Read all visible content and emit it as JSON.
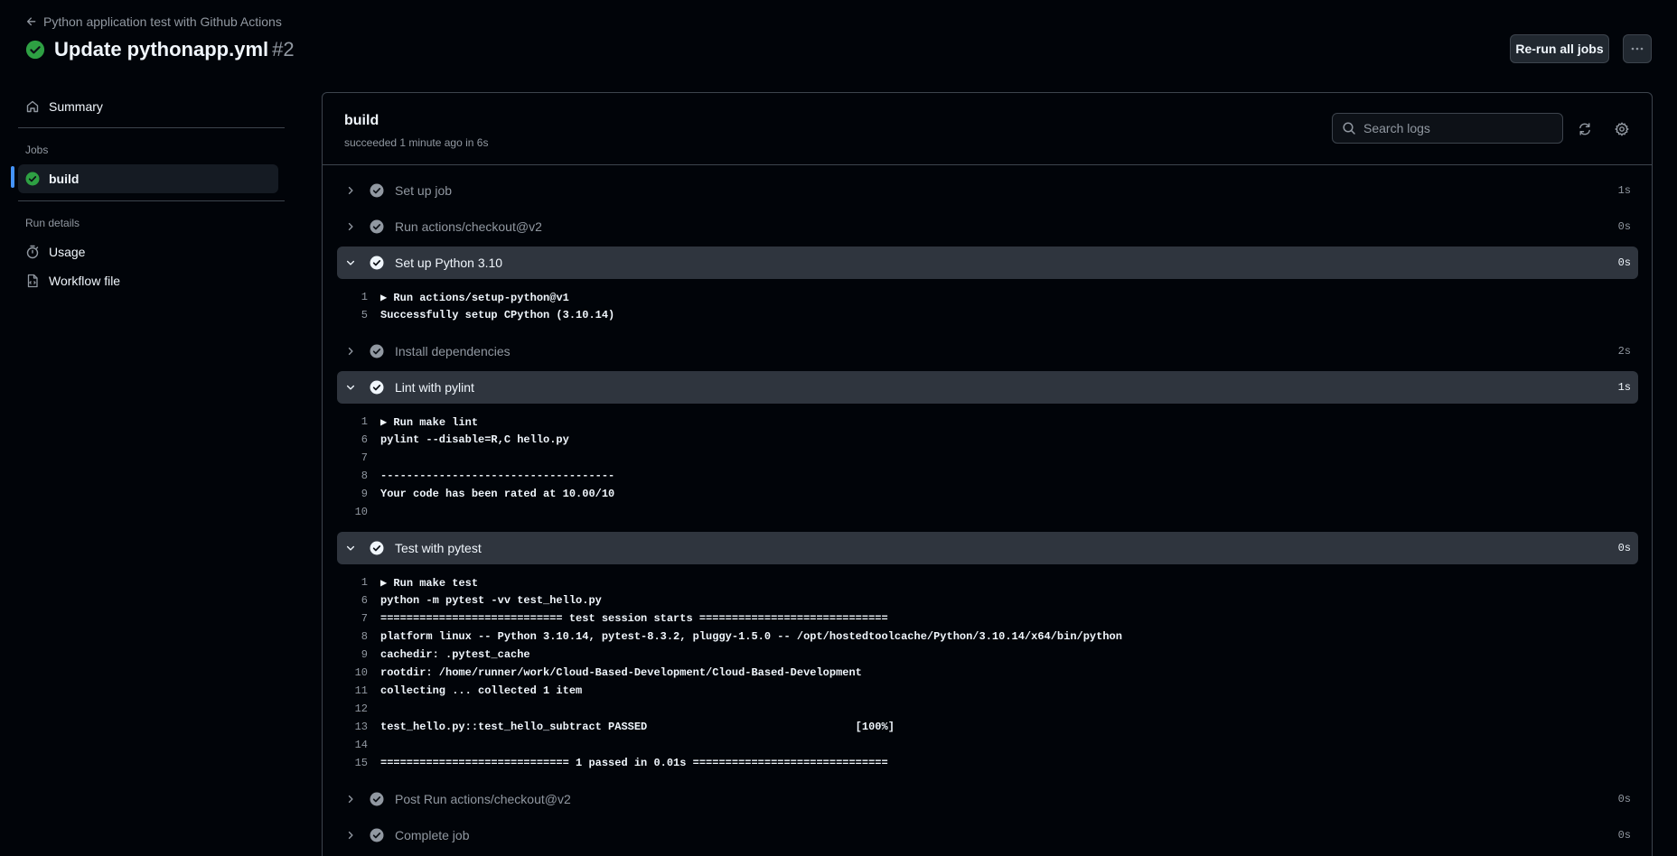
{
  "header": {
    "back_label": "Python application test with Github Actions",
    "title": "Update pythonapp.yml",
    "run_number": "#2",
    "rerun_label": "Re-run all jobs"
  },
  "sidebar": {
    "summary_label": "Summary",
    "jobs_heading": "Jobs",
    "build_label": "build",
    "run_details_heading": "Run details",
    "usage_label": "Usage",
    "workflow_file_label": "Workflow file"
  },
  "job": {
    "name": "build",
    "status": "succeeded 1 minute ago in 6s",
    "search_placeholder": "Search logs"
  },
  "steps": [
    {
      "label": "Set up job",
      "duration": "1s",
      "expanded": false,
      "lines": []
    },
    {
      "label": "Run actions/checkout@v2",
      "duration": "0s",
      "expanded": false,
      "lines": []
    },
    {
      "label": "Set up Python 3.10",
      "duration": "0s",
      "expanded": true,
      "lines": [
        {
          "n": "1",
          "text": "▶ Run actions/setup-python@v1"
        },
        {
          "n": "5",
          "text": "Successfully setup CPython (3.10.14)"
        }
      ]
    },
    {
      "label": "Install dependencies",
      "duration": "2s",
      "expanded": false,
      "lines": []
    },
    {
      "label": "Lint with pylint",
      "duration": "1s",
      "expanded": true,
      "lines": [
        {
          "n": "1",
          "text": "▶ Run make lint"
        },
        {
          "n": "6",
          "text": "pylint --disable=R,C hello.py"
        },
        {
          "n": "7",
          "text": ""
        },
        {
          "n": "8",
          "text": "------------------------------------"
        },
        {
          "n": "9",
          "text": "Your code has been rated at 10.00/10"
        },
        {
          "n": "10",
          "text": ""
        }
      ]
    },
    {
      "label": "Test with pytest",
      "duration": "0s",
      "expanded": true,
      "lines": [
        {
          "n": "1",
          "text": "▶ Run make test"
        },
        {
          "n": "6",
          "text": "python -m pytest -vv test_hello.py"
        },
        {
          "n": "7",
          "text": "============================ test session starts ============================="
        },
        {
          "n": "8",
          "text": "platform linux -- Python 3.10.14, pytest-8.3.2, pluggy-1.5.0 -- /opt/hostedtoolcache/Python/3.10.14/x64/bin/python"
        },
        {
          "n": "9",
          "text": "cachedir: .pytest_cache"
        },
        {
          "n": "10",
          "text": "rootdir: /home/runner/work/Cloud-Based-Development/Cloud-Based-Development"
        },
        {
          "n": "11",
          "text": "collecting ... collected 1 item"
        },
        {
          "n": "12",
          "text": ""
        },
        {
          "n": "13",
          "text": "test_hello.py::test_hello_subtract PASSED                                [100%]"
        },
        {
          "n": "14",
          "text": ""
        },
        {
          "n": "15",
          "text": "============================= 1 passed in 0.01s =============================="
        }
      ]
    },
    {
      "label": "Post Run actions/checkout@v2",
      "duration": "0s",
      "expanded": false,
      "lines": []
    },
    {
      "label": "Complete job",
      "duration": "0s",
      "expanded": false,
      "lines": []
    }
  ],
  "colors": {
    "success": "#2ea043",
    "step_check": "#9198a1",
    "accent": "#4493f8"
  },
  "icons": {
    "back": "arrow-left-icon",
    "status": "check-circle-fill-icon",
    "more": "kebab-horizontal-icon",
    "summary": "home-icon",
    "usage": "stopwatch-icon",
    "workflow_file": "file-code-icon",
    "search": "search-icon",
    "refresh": "sync-icon",
    "settings": "gear-icon",
    "chevron_right": "chevron-right-icon",
    "chevron_down": "chevron-down-icon"
  }
}
